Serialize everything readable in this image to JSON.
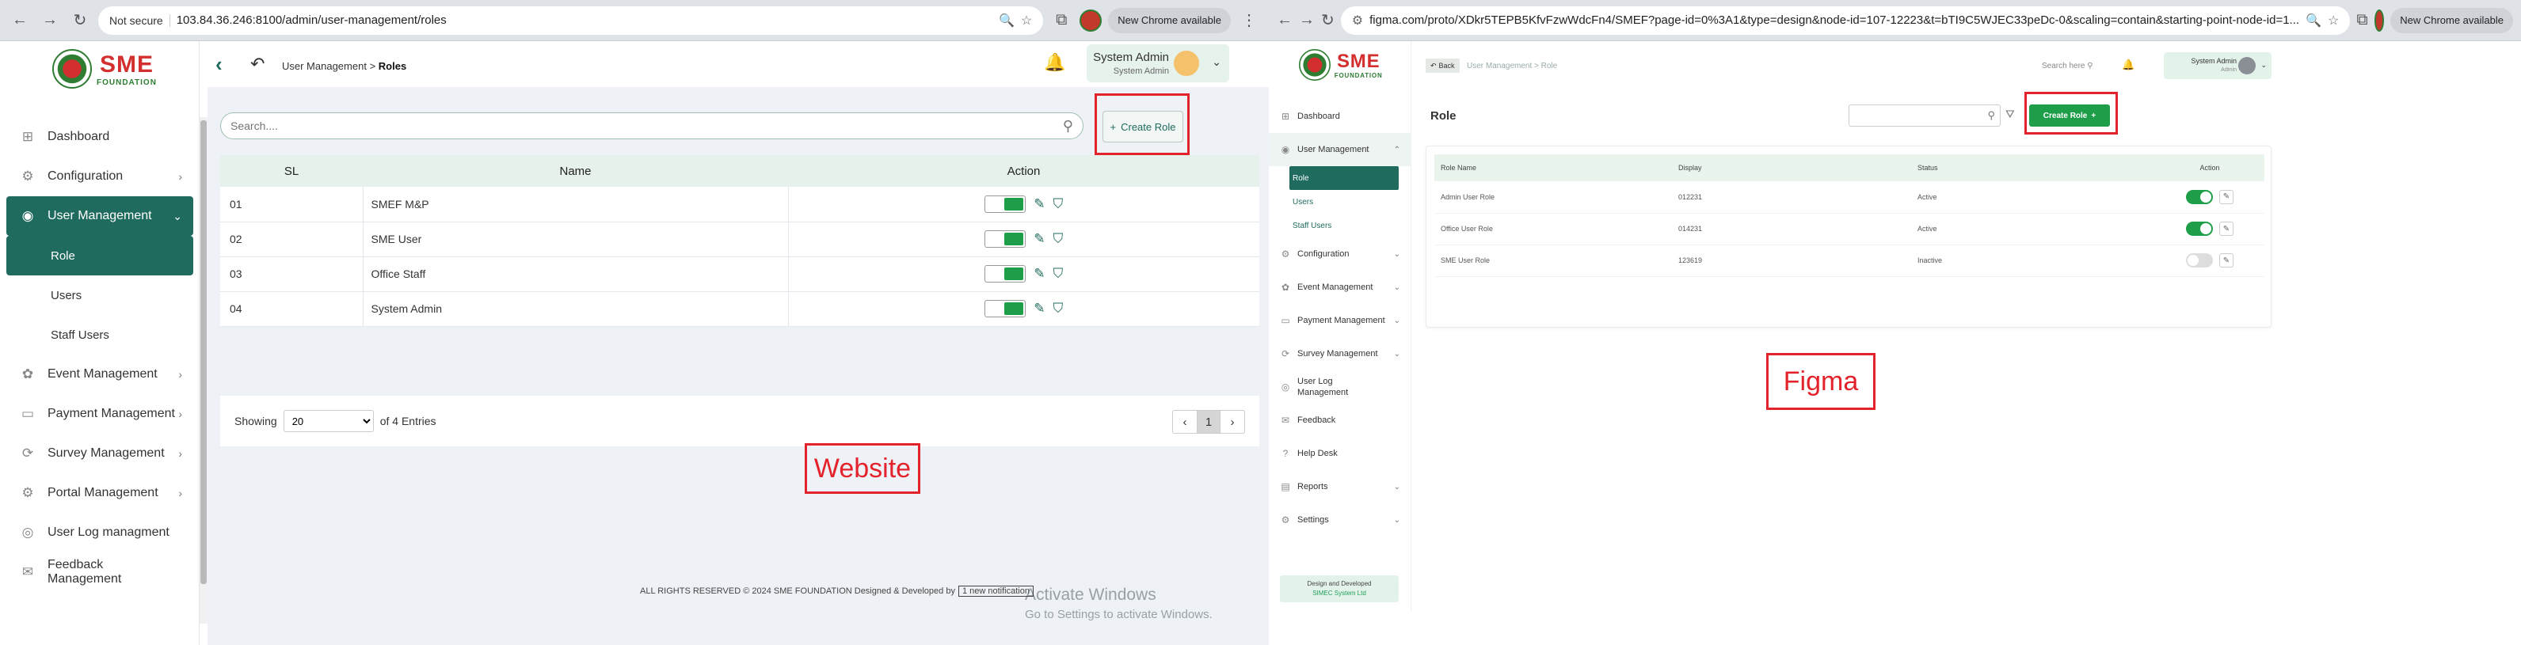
{
  "left_browser": {
    "not_secure": "Not secure",
    "url": "103.84.36.246:8100/admin/user-management/roles",
    "new_chrome": "New Chrome available"
  },
  "right_browser": {
    "url": "figma.com/proto/XDkr5TEPB5KfvFzwWdcFn4/SMEF?page-id=0%3A1&type=design&node-id=107-12223&t=bTI9C5WJEC33peDc-0&scaling=contain&starting-point-node-id=1...",
    "new_chrome": "New Chrome available"
  },
  "logo": {
    "text": "SME",
    "sub": "FOUNDATION"
  },
  "website": {
    "nav": [
      {
        "label": "Dashboard",
        "icon": "dashboard-icon"
      },
      {
        "label": "Configuration",
        "icon": "gear-icon"
      },
      {
        "label": "User Management",
        "icon": "user-icon"
      },
      {
        "label": "Role"
      },
      {
        "label": "Users"
      },
      {
        "label": "Staff Users"
      },
      {
        "label": "Event Management",
        "icon": "event-icon"
      },
      {
        "label": "Payment Management",
        "icon": "payment-icon"
      },
      {
        "label": "Survey Management",
        "icon": "survey-icon"
      },
      {
        "label": "Portal Management",
        "icon": "portal-icon"
      },
      {
        "label": "User Log managment",
        "icon": "log-icon"
      },
      {
        "label": "Feedback Management",
        "icon": "feedback-icon"
      }
    ],
    "breadcrumb": {
      "parent": "User Management",
      "sep": ">",
      "current": "Roles"
    },
    "user": {
      "name": "System Admin",
      "role": "System Admin"
    },
    "search_placeholder": "Search....",
    "create_label": "Create Role",
    "table": {
      "headers": [
        "SL",
        "Name",
        "Action"
      ],
      "rows": [
        {
          "sl": "01",
          "name": "SMEF M&P"
        },
        {
          "sl": "02",
          "name": "SME User"
        },
        {
          "sl": "03",
          "name": "Office Staff"
        },
        {
          "sl": "04",
          "name": "System Admin"
        }
      ]
    },
    "pagination": {
      "showing": "Showing",
      "per_page": "20",
      "entries": "of 4 Entries",
      "page": "1"
    },
    "annotation_label": "Website",
    "activate_title": "Activate Windows",
    "activate_sub": "Go to Settings to activate Windows.",
    "copyright": "ALL RIGHTS RESERVED © 2024 SME FOUNDATION  Designed & Developed by",
    "copyright_tail": "1 new notification"
  },
  "figma": {
    "nav": [
      {
        "label": "Dashboard"
      },
      {
        "label": "User Management"
      },
      {
        "label": "Role"
      },
      {
        "label": "Users"
      },
      {
        "label": "Staff Users"
      },
      {
        "label": "Configuration"
      },
      {
        "label": "Event Management"
      },
      {
        "label": "Payment Management"
      },
      {
        "label": "Survey Management"
      },
      {
        "label": "User Log Management"
      },
      {
        "label": "Feedback"
      },
      {
        "label": "Help Desk"
      },
      {
        "label": "Reports"
      },
      {
        "label": "Settings"
      }
    ],
    "badge_line1": "Design and Developed",
    "badge_line2": "SIMEC System Ltd",
    "back": "Back",
    "breadcrumb": {
      "parent": "User Management",
      "current": "Role"
    },
    "search_here": "Search here",
    "user": {
      "name": "System Admin",
      "role": "Admin"
    },
    "title": "Role",
    "create_label": "Create Role",
    "table": {
      "headers": [
        "Role Name",
        "Display",
        "Status",
        "Action"
      ],
      "rows": [
        {
          "name": "Admin User Role",
          "display": "012231",
          "status": "Active",
          "on": true
        },
        {
          "name": "Office User Role",
          "display": "014231",
          "status": "Active",
          "on": true
        },
        {
          "name": "SME User Role",
          "display": "123619",
          "status": "Inactive",
          "on": false
        }
      ]
    },
    "annotation_label": "Figma"
  },
  "colors": {
    "brand": "#1f6b5e",
    "green": "#1e9e48",
    "annotation": "#e3222b"
  }
}
